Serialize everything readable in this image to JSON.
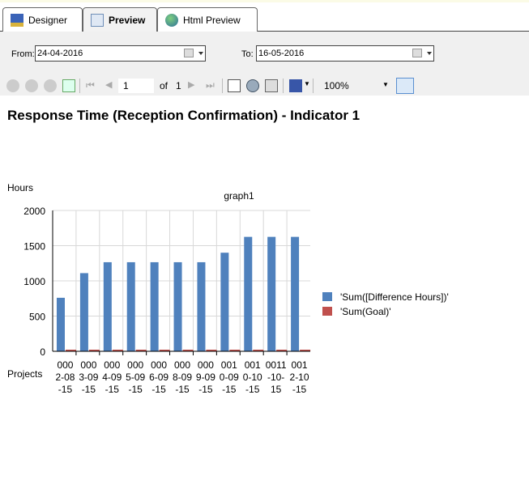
{
  "tabs": [
    {
      "label": "Designer"
    },
    {
      "label": "Preview"
    },
    {
      "label": "Html Preview"
    }
  ],
  "params": {
    "from_label": "From:",
    "from_value": "24-04-2016",
    "to_label": "To:",
    "to_value": "16-05-2016"
  },
  "toolbar": {
    "page": "1",
    "of_label": "of",
    "total_pages": "1",
    "zoom": "100%"
  },
  "report_title": "Response Time (Reception Confirmation) - Indicator 1",
  "chart_data": {
    "type": "bar",
    "title": "graph1",
    "ylabel": "Hours",
    "xlabel": "Projects",
    "ylim": [
      0,
      2000
    ],
    "yticks": [
      "0",
      "500",
      "1000",
      "1500",
      "2000"
    ],
    "grid": true,
    "legend_position": "right",
    "categories": [
      [
        "000",
        "2-08",
        "-15"
      ],
      [
        "000",
        "3-09",
        "-15"
      ],
      [
        "000",
        "4-09",
        "-15"
      ],
      [
        "000",
        "5-09",
        "-15"
      ],
      [
        "000",
        "6-09",
        "-15"
      ],
      [
        "000",
        "8-09",
        "-15"
      ],
      [
        "000",
        "9-09",
        "-15"
      ],
      [
        "001",
        "0-09",
        "-15"
      ],
      [
        "001",
        "0-10",
        "-15"
      ],
      [
        "0011",
        "-10-",
        "15"
      ],
      [
        "001",
        "2-10",
        "-15"
      ]
    ],
    "series": [
      {
        "name": "'Sum([Difference Hours])'",
        "color": "#4f81bd",
        "values": [
          760,
          1110,
          1265,
          1265,
          1265,
          1265,
          1265,
          1400,
          1625,
          1625,
          1625
        ]
      },
      {
        "name": "'Sum(Goal)'",
        "color": "#c0504d",
        "values": [
          15,
          15,
          15,
          15,
          15,
          15,
          15,
          15,
          15,
          15,
          15
        ]
      }
    ]
  }
}
